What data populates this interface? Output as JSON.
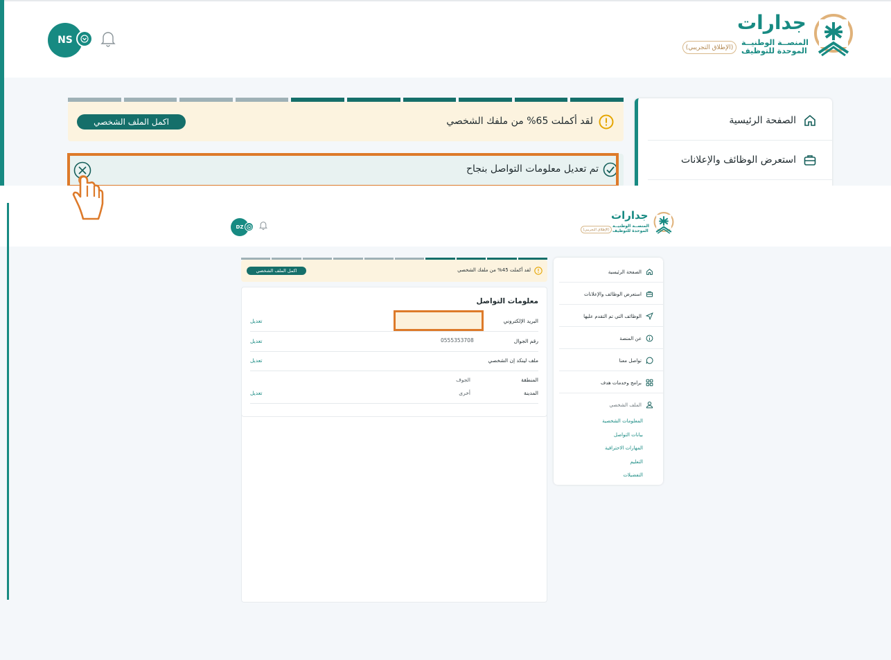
{
  "brand": {
    "name": "جدارات",
    "subtitle_line1": "المنصــة الوطنيــة",
    "subtitle_line2": "الموحدة للتوظيف",
    "trial_badge": "(الإطلاق التجريبي)",
    "accent": "#178a82",
    "banner_bg": "#fcf3df",
    "highlight": "#dd7a2a"
  },
  "zoom": {
    "avatar_initials": "NS",
    "progress_text": "لقد أكملت 65% من ملفك الشخصي",
    "complete_profile_button": "اكمل الملف الشخصي",
    "success_message": "تم تعديل معلومات التواصل بنجاح",
    "nav": [
      "الصفحة الرئيسية",
      "استعرض الوظائف والإعلانات"
    ],
    "progress_segments_total": 10,
    "progress_segments_done": 6
  },
  "full": {
    "avatar_initials": "DZ",
    "progress_text": "لقد أكملت 45% من ملفك الشخصي",
    "complete_profile_button": "اكمل الملف الشخصي",
    "progress_segments_total": 10,
    "progress_segments_done": 4,
    "nav": [
      "الصفحة الرئيسية",
      "استعرض الوظائف والإعلانات",
      "الوظائف التي تم التقدم عليها",
      "عن المنصة",
      "تواصل معنا",
      "برامج وخدمات هدف",
      "الملف الشخصي"
    ],
    "profile_submenu": [
      "المعلومات الشخصية",
      "بيانات التواصل",
      "المهارات الاحترافية",
      "التعليم",
      "التفضيلات"
    ],
    "contact": {
      "title": "معلومات التواصل",
      "edit_label": "تعديل",
      "email_label": "البريد الإلكتروني",
      "email_value": "",
      "mobile_label": "رقم الجوال",
      "mobile_value": "0555353708",
      "linkedin_label": "ملف لينكد إن الشخصي",
      "region_label": "المنطقة",
      "region_value": "الجوف",
      "city_label": "المدينة",
      "city_value": "أخرى"
    }
  }
}
